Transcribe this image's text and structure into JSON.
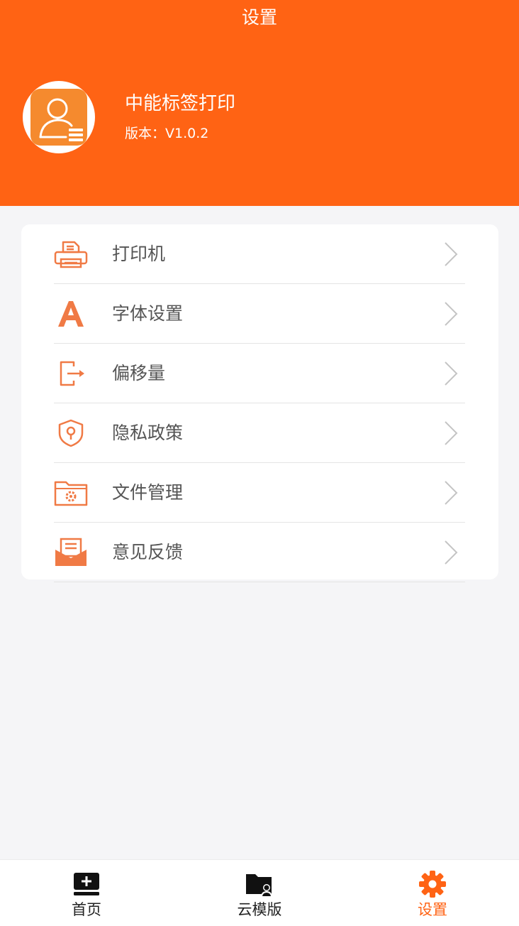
{
  "header": {
    "title": "设置",
    "app_name": "中能标签打印",
    "version_label": "版本：",
    "version_value": "V1.0.2"
  },
  "colors": {
    "accent": "#ff6314",
    "icon": "#f07a45",
    "text": "#555555",
    "background": "#f5f5f7"
  },
  "menu": {
    "items": [
      {
        "label": "打印机",
        "icon": "printer-icon"
      },
      {
        "label": "字体设置",
        "icon": "font-icon"
      },
      {
        "label": "偏移量",
        "icon": "offset-icon"
      },
      {
        "label": "隐私政策",
        "icon": "shield-icon"
      },
      {
        "label": "文件管理",
        "icon": "folder-gear-icon"
      },
      {
        "label": "意见反馈",
        "icon": "feedback-mail-icon"
      }
    ]
  },
  "tabbar": {
    "items": [
      {
        "label": "首页",
        "icon": "home-add-icon",
        "active": false
      },
      {
        "label": "云模版",
        "icon": "cloud-folder-icon",
        "active": false
      },
      {
        "label": "设置",
        "icon": "gear-icon",
        "active": true
      }
    ]
  }
}
